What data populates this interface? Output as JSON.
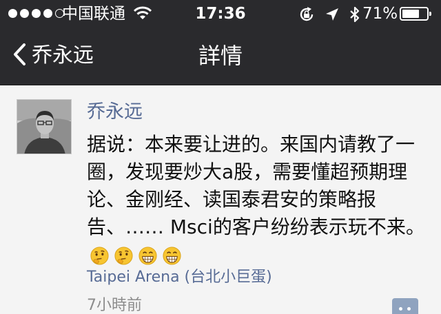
{
  "status_bar": {
    "carrier": "中国联通",
    "time": "17:36",
    "battery": "71%",
    "battery_level": 0.71,
    "signal_bars": 4,
    "signal_max": 5
  },
  "nav": {
    "back_label": "乔永远",
    "title": "詳情"
  },
  "post": {
    "author": "乔永远",
    "text": "据说：本来要让进的。来国内请教了一圈，发现要炒大a股，需要懂超预期理论、金刚经、读国泰君安的策略报告、…… Msci的客户纷纷表示玩不来。",
    "emojis": [
      "thinking-face",
      "thinking-face",
      "grinning-face",
      "grinning-face"
    ],
    "location": "Taipei Arena (台北小巨蛋)",
    "time": "7小時前"
  },
  "colors": {
    "bar_bg": "#2a2a2d",
    "link": "#576b95",
    "content_bg": "#f4f4f4",
    "comment_button": "#8fa3bf"
  }
}
